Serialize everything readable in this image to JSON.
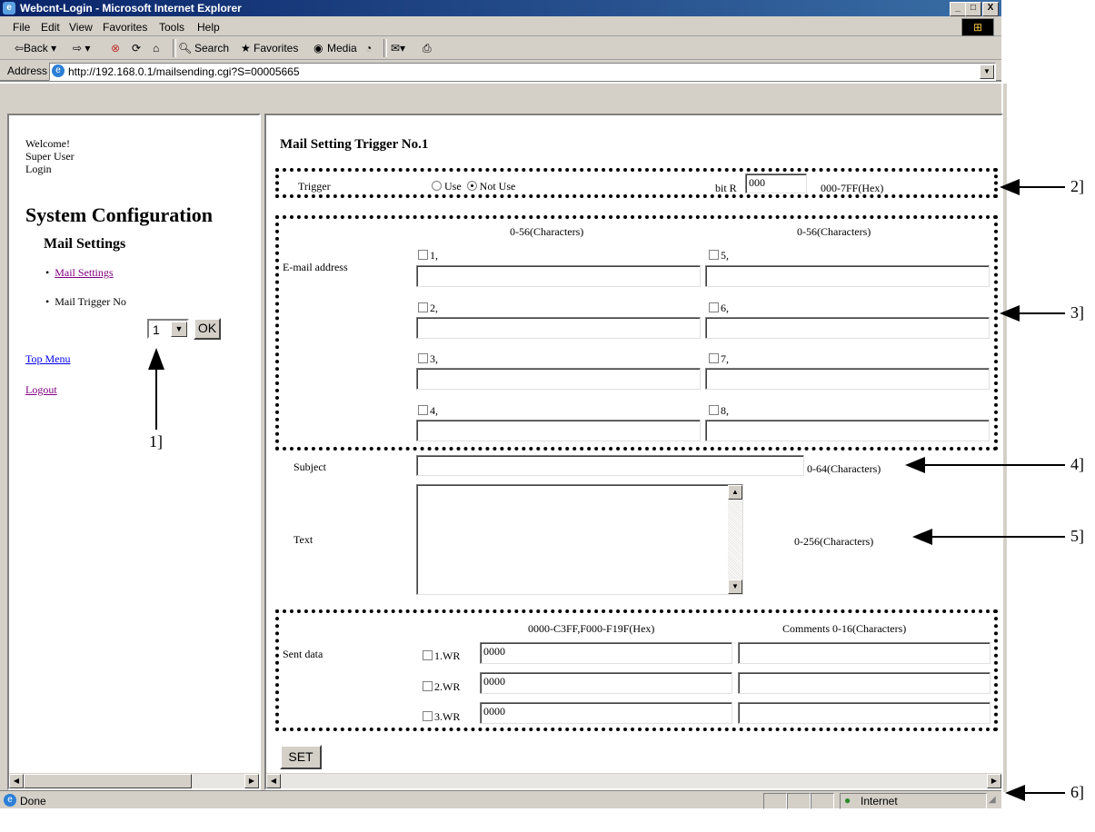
{
  "window": {
    "title": "Webcnt-Login - Microsoft Internet Explorer",
    "buttons": [
      "_",
      "□",
      "X"
    ]
  },
  "menu": [
    "File",
    "Edit",
    "View",
    "Favorites",
    "Tools",
    "Help"
  ],
  "toolbar": {
    "back": "⇦Back ▾",
    "forward": "⇨ ▾",
    "search": "Search",
    "favorites": "Favorites",
    "media": "Media"
  },
  "address": {
    "label": "Address",
    "url": "http://192.168.0.1/mailsending.cgi?S=00005665"
  },
  "sidebar": {
    "welcome": "Welcome!",
    "user": "Super User",
    "login": "Login",
    "heading": "System Configuration",
    "subheading": "Mail Settings",
    "items": [
      "Mail Settings",
      "Mail Trigger No"
    ],
    "trigger_select": "1",
    "ok_label": "OK",
    "top_menu": "Top Menu",
    "logout": "Logout"
  },
  "main": {
    "title": "Mail Setting Trigger No.1",
    "trigger": {
      "label": "Trigger",
      "use": "Use",
      "not_use": "Not Use",
      "bit_label": "bit R",
      "bit_value": "000",
      "range": "000-7FF(Hex)"
    },
    "email": {
      "label": "E-mail address",
      "hint_left": "0-56(Characters)",
      "hint_right": "0-56(Characters)",
      "slots": [
        "1,",
        "2,",
        "3,",
        "4,",
        "5,",
        "6,",
        "7,",
        "8,"
      ]
    },
    "subject": {
      "label": "Subject",
      "hint": "0-64(Characters)"
    },
    "text": {
      "label": "Text",
      "hint": "0-256(Characters)"
    },
    "sent": {
      "label": "Sent data",
      "hint_range": "0000-C3FF,F000-F19F(Hex)",
      "hint_comments": "Comments 0-16(Characters)",
      "rows": [
        {
          "name": "1.WR",
          "value": "0000"
        },
        {
          "name": "2.WR",
          "value": "0000"
        },
        {
          "name": "3.WR",
          "value": "0000"
        }
      ]
    },
    "set_label": "SET"
  },
  "status": {
    "left": "Done",
    "zone": "Internet"
  },
  "callouts": [
    "1]",
    "2]",
    "3]",
    "4]",
    "5]",
    "6]"
  ]
}
